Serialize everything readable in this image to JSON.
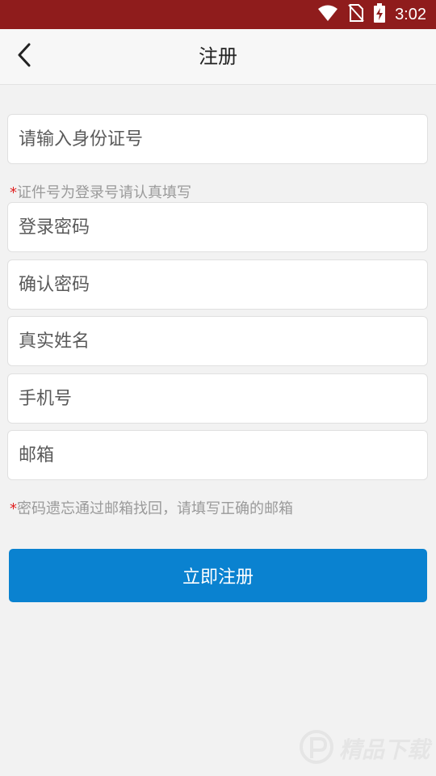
{
  "status_bar": {
    "time": "3:02",
    "icons": [
      "wifi-icon",
      "no-sim-icon",
      "battery-charging-icon"
    ],
    "background": "#8f1c1c"
  },
  "header": {
    "title": "注册",
    "back_icon": "chevron-left-icon"
  },
  "form": {
    "id_number_placeholder": "请输入身份证号",
    "id_hint": "证件号为登录号请认真填写",
    "password_placeholder": "登录密码",
    "confirm_password_placeholder": "确认密码",
    "real_name_placeholder": "真实姓名",
    "phone_placeholder": "手机号",
    "email_placeholder": "邮箱",
    "email_hint": "密码遗忘通过邮箱找回，请填写正确的邮箱",
    "hint_mark": "*",
    "submit_label": "立即注册"
  },
  "watermark": {
    "text": "精品下载"
  },
  "colors": {
    "accent": "#0a82d0",
    "required_mark": "#e02020",
    "background": "#f2f2f2"
  }
}
